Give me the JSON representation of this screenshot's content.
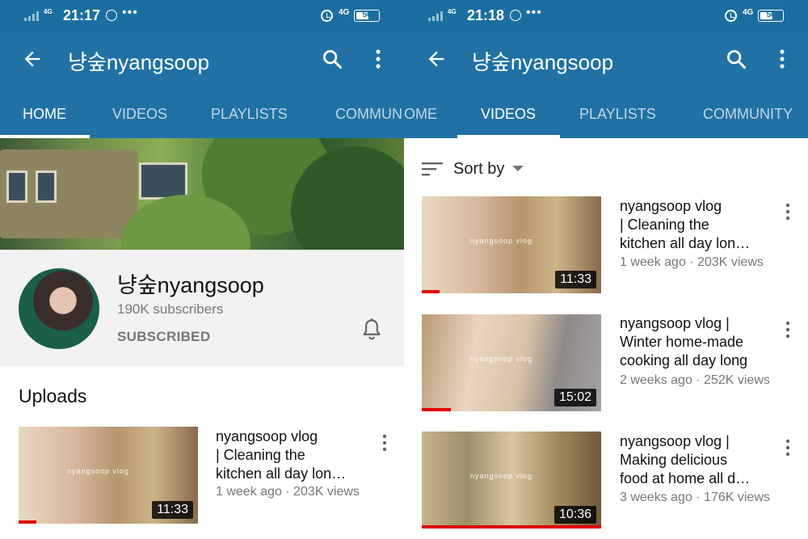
{
  "status_left": {
    "time": "21:17",
    "network": "4G",
    "network_right": "4G",
    "battery": "50"
  },
  "status_right": {
    "time": "21:18",
    "network": "4G",
    "network_right": "4G",
    "battery": "50"
  },
  "channel": {
    "title": "냥숲nyangsoop",
    "name": "냥숲nyangsoop",
    "subscribers": "190K subscribers",
    "subscribed_label": "SUBSCRIBED"
  },
  "tabs_left": [
    "HOME",
    "VIDEOS",
    "PLAYLISTS",
    "COMMUN"
  ],
  "tabs_right": [
    "OME",
    "VIDEOS",
    "PLAYLISTS",
    "COMMUNITY"
  ],
  "uploads_heading": "Uploads",
  "sort_label": "Sort by",
  "uploads": [
    {
      "title": "nyangsoop vlog\n| Cleaning the\nkitchen all day lon…",
      "meta": "1 week ago · 203K views",
      "duration": "11:33",
      "watched": 0.1
    }
  ],
  "videos": [
    {
      "title": "nyangsoop vlog\n| Cleaning the\nkitchen all day lon…",
      "meta": "1 week ago · 203K views",
      "duration": "11:33",
      "watched": 0.1
    },
    {
      "title": "nyangsoop vlog |\nWinter home-made\ncooking all day long",
      "meta": "2 weeks ago · 252K views",
      "duration": "15:02",
      "watched": 0.16
    },
    {
      "title": "nyangsoop vlog |\nMaking delicious\nfood at home all d…",
      "meta": "3 weeks ago · 176K views",
      "duration": "10:36",
      "watched": 1.0
    }
  ],
  "colors": {
    "appbar": "#2171a5",
    "statusbar": "#1b6fa0",
    "progress": "#e00000"
  }
}
